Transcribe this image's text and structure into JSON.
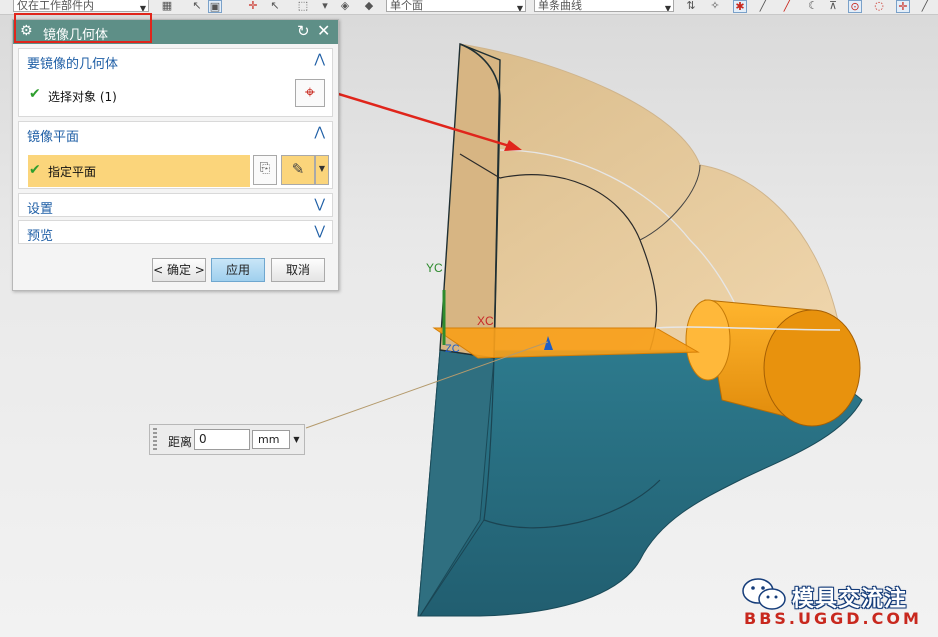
{
  "toolbar": {
    "filter_value": "仅在工作部件内",
    "face_rule_value": "单个面",
    "curve_rule_value": "单条曲线"
  },
  "dialog": {
    "title": "镜像几何体",
    "sections": {
      "geometry": {
        "label": "要镜像的几何体",
        "expanded": true,
        "select_label": "选择对象 (1)"
      },
      "plane": {
        "label": "镜像平面",
        "expanded": true,
        "specify_label": "指定平面"
      },
      "settings": {
        "label": "设置",
        "expanded": false
      },
      "preview": {
        "label": "预览",
        "expanded": false
      }
    },
    "buttons": {
      "ok": "< 确定 >",
      "apply": "应用",
      "cancel": "取消"
    }
  },
  "viewport": {
    "axis_labels": {
      "yc": "YC",
      "xc": "XC",
      "zc": "ZC"
    },
    "model_colors": {
      "top_translucent": "#e7c48f",
      "bottom_solid": "#2c7084",
      "plane": "#f7a01a",
      "cylinder": "#f29a12"
    }
  },
  "distance_input": {
    "label": "距离",
    "value": "0",
    "unit": "mm"
  },
  "watermark": {
    "text": "模具交流注",
    "url": "BBS.UGGD.COM"
  }
}
